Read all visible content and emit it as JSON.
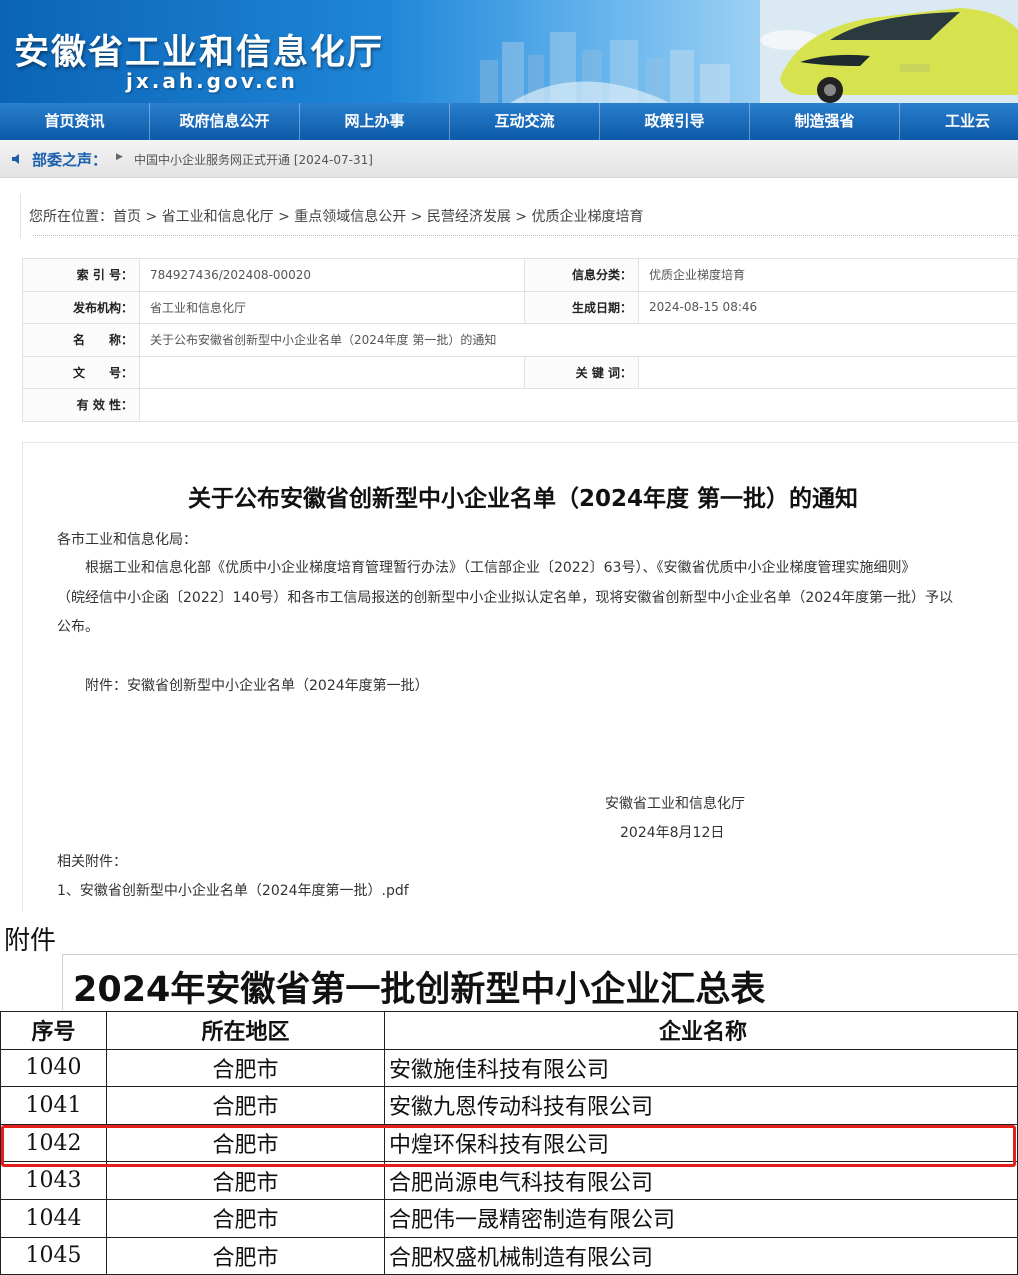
{
  "site": {
    "title": "安徽省工业和信息化厅",
    "domain": "jx.ah.gov.cn"
  },
  "nav": [
    "首页资讯",
    "政府信息公开",
    "网上办事",
    "互动交流",
    "政策引导",
    "制造强省",
    "工业云"
  ],
  "notice": {
    "label": "部委之声：",
    "text": "中国中小企业服务网正式开通 [2024-07-31]"
  },
  "breadcrumb": "您所在位置：首页 > 省工业和信息化厅 > 重点领域信息公开 > 民营经济发展 > 优质企业梯度培育",
  "meta": {
    "index_label": "索 引 号：",
    "index_value": "784927436/202408-00020",
    "category_label": "信息分类：",
    "category_value": "优质企业梯度培育",
    "publisher_label": "发布机构：",
    "publisher_value": "省工业和信息化厅",
    "date_label": "生成日期：",
    "date_value": "2024-08-15 08:46",
    "name_label": "名　　称：",
    "name_value": "关于公布安徽省创新型中小企业名单（2024年度 第一批）的通知",
    "docno_label": "文　　号：",
    "docno_value": "",
    "keyword_label": "关 键 词：",
    "keyword_value": "",
    "validity_label": "有 效 性：",
    "validity_value": ""
  },
  "article": {
    "title": "关于公布安徽省创新型中小企业名单（2024年度 第一批）的通知",
    "salutation": "各市工业和信息化局：",
    "body_line1": "根据工业和信息化部《优质中小企业梯度培育管理暂行办法》（工信部企业〔2022〕63号）、《安徽省优质中小企业梯度管理实施细则》",
    "body_line2": "（皖经信中小企函〔2022〕140号）和各市工信局报送的创新型中小企业拟认定名单，现将安徽省创新型中小企业名单（2024年度第一批）予以",
    "body_line3": "公布。",
    "attachment_note": "附件：安徽省创新型中小企业名单（2024年度第一批）",
    "signature": "安徽省工业和信息化厅",
    "sign_date": "2024年8月12日",
    "related_label": "相关附件：",
    "related_file": "1、安徽省创新型中小企业名单（2024年度第一批）.pdf"
  },
  "attachment": {
    "label": "附件",
    "title": "2024年安徽省第一批创新型中小企业汇总表",
    "headers": [
      "序号",
      "所在地区",
      "企业名称"
    ],
    "rows": [
      [
        "1040",
        "合肥市",
        "安徽施佳科技有限公司"
      ],
      [
        "1041",
        "合肥市",
        "安徽九恩传动科技有限公司"
      ],
      [
        "1042",
        "合肥市",
        "中煌环保科技有限公司"
      ],
      [
        "1043",
        "合肥市",
        "合肥尚源电气科技有限公司"
      ],
      [
        "1044",
        "合肥市",
        "合肥伟一晟精密制造有限公司"
      ],
      [
        "1045",
        "合肥市",
        "合肥权盛机械制造有限公司"
      ]
    ],
    "highlight_color": "#e3201b"
  }
}
